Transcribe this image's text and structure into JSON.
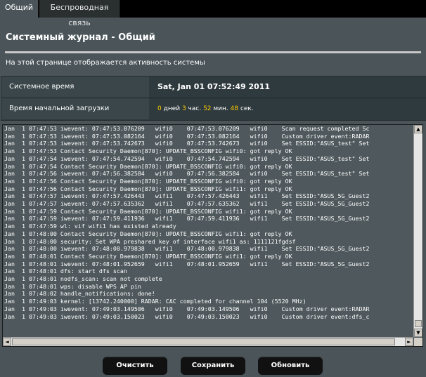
{
  "tabs": {
    "general": "Общий",
    "wireless": "Беспроводная связь"
  },
  "page": {
    "title": "Системный журнал - Общий",
    "description": "На этой странице отображается активность системы"
  },
  "info": {
    "system_time_label": "Системное время",
    "system_time_value": "Sat, Jan 01 07:52:49 2011",
    "uptime_label": "Время начальной загрузки",
    "uptime": {
      "days": "0",
      "days_unit": " дней ",
      "hours": "3",
      "hours_unit": " час. ",
      "minutes": "52",
      "minutes_unit": " мин. ",
      "seconds": "48",
      "seconds_unit": " сек."
    }
  },
  "log_lines": [
    "Jan  1 07:47:53 iwevent: 07:47:53.076209   wifi0    07:47:53.076209   wifi0    Scan request completed Sc",
    "Jan  1 07:47:53 iwevent: 07:47:53.082164   wifi0    07:47:53.082164   wifi0    Custom driver event:RADAR",
    "Jan  1 07:47:53 iwevent: 07:47:53.742673   wifi0    07:47:53.742673   wifi0    Set ESSID:\"ASUS_test\" Set",
    "Jan  1 07:47:53 Contact Security Daemon[870]: UPDATE_BSSCONFIG wifi0: got reply OK",
    "Jan  1 07:47:54 iwevent: 07:47:54.742594   wifi0    07:47:54.742594   wifi0    Set ESSID:\"ASUS_test\" Set",
    "Jan  1 07:47:54 Contact Security Daemon[870]: UPDATE_BSSCONFIG wifi0: got reply OK",
    "Jan  1 07:47:56 iwevent: 07:47:56.382584   wifi0    07:47:56.382584   wifi0    Set ESSID:\"ASUS_test\" Set",
    "Jan  1 07:47:56 Contact Security Daemon[870]: UPDATE_BSSCONFIG wifi0: got reply OK",
    "Jan  1 07:47:56 Contact Security Daemon[870]: UPDATE_BSSCONFIG wifi1: got reply OK",
    "Jan  1 07:47:57 iwevent: 07:47:57.426443   wifi1    07:47:57.426443   wifi1    Set ESSID:\"ASUS_5G_Guest2",
    "Jan  1 07:47:57 iwevent: 07:47:57.635362   wifi1    07:47:57.635362   wifi1    Set ESSID:\"ASUS_5G_Guest2",
    "Jan  1 07:47:59 Contact Security Daemon[870]: UPDATE_BSSCONFIG wifi1: got reply OK",
    "Jan  1 07:47:59 iwevent: 07:47:59.411936   wifi1    07:47:59.411936   wifi1    Set ESSID:\"ASUS_5G_Guest2",
    "Jan  1 07:47:59 wl: vif wifi1 has existed already",
    "Jan  1 07:48:00 Contact Security Daemon[870]: UPDATE_BSSCONFIG wifi1: got reply OK",
    "Jan  1 07:48:00 security: Set WPA preshared key of interface wifi1 as: 1111121fgdsf",
    "Jan  1 07:48:00 iwevent: 07:48:00.979838   wifi1    07:48:00.979838   wifi1    Set ESSID:\"ASUS_5G_Guest2",
    "Jan  1 07:48:01 Contact Security Daemon[870]: UPDATE_BSSCONFIG wifi1: got reply OK",
    "Jan  1 07:48:01 iwevent: 07:48:01.952659   wifi1    07:48:01.952659   wifi1    Set ESSID:\"ASUS_5G_Guest2",
    "Jan  1 07:48:01 dfs: start dfs scan",
    "Jan  1 07:48:01 nodfs_scan: scan not complete",
    "Jan  1 07:48:01 wps: disable WPS AP pin",
    "Jan  1 07:48:02 handle_notifications: done!",
    "Jan  1 07:49:03 kernel: [13742.240000] RADAR: CAC completed for channel 104 (5520 MHz)",
    "Jan  1 07:49:03 iwevent: 07:49:03.149506   wifi0    07:49:03.149506   wifi0    Custom driver event:RADAR",
    "Jan  1 07:49:03 iwevent: 07:49:03.150023   wifi0    07:49:03.150023   wifi0    Custom driver event:dfs_c"
  ],
  "buttons": {
    "clear": "Очистить",
    "save": "Сохранить",
    "refresh": "Обновить"
  },
  "scroll_icons": {
    "up": "▲",
    "down": "▼",
    "left": "◄",
    "right": "►"
  },
  "colors": {
    "background": "#4a5459",
    "accent_number": "#ffcc00",
    "tabbar": "#000000"
  }
}
